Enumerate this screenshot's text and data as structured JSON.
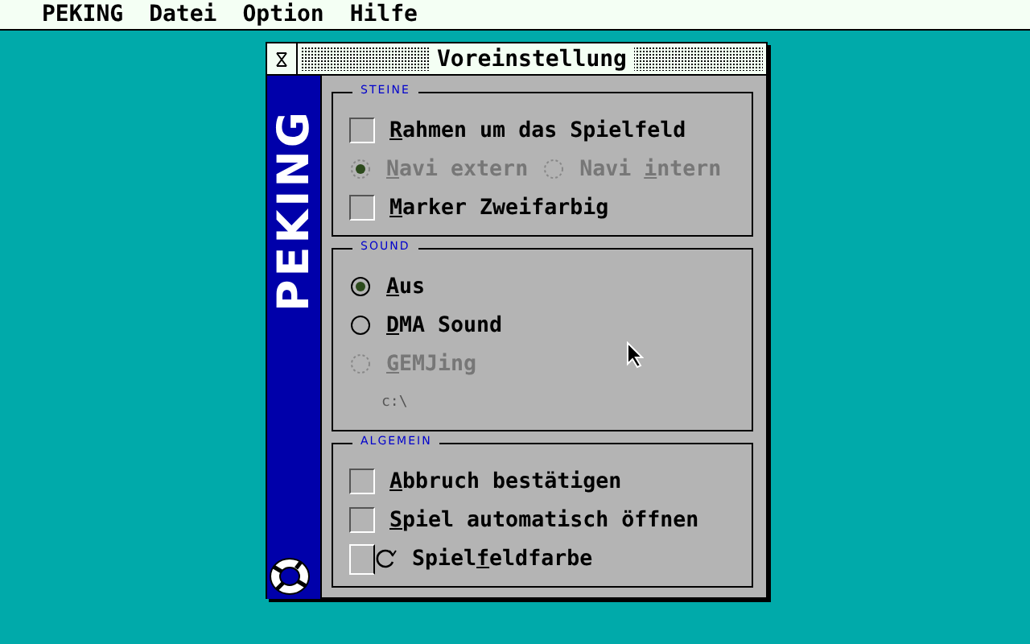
{
  "menu_bar": [
    {
      "label": "PEKING"
    },
    {
      "label": "Datei"
    },
    {
      "label": "Option"
    },
    {
      "label": "Hilfe"
    }
  ],
  "window": {
    "title": "Voreinstellung",
    "sidebar_label": "PEKING"
  },
  "groups": [
    {
      "title": "STEINE",
      "rows": [
        {
          "items": [
            {
              "kind": "checkbox",
              "key": "R",
              "after": "ahmen um das Spielfeld",
              "checked": false,
              "disabled": false
            }
          ]
        },
        {
          "items": [
            {
              "kind": "radio",
              "key": "N",
              "after": "avi extern",
              "selected": true,
              "disabled": true
            },
            {
              "kind": "radio",
              "before": "Navi ",
              "key": "i",
              "after": "ntern",
              "selected": false,
              "disabled": true
            }
          ]
        },
        {
          "items": [
            {
              "kind": "checkbox",
              "key": "M",
              "after": "arker Zweifarbig",
              "checked": false,
              "disabled": false
            }
          ]
        }
      ]
    },
    {
      "title": "SOUND",
      "rows": [
        {
          "items": [
            {
              "kind": "radio",
              "key": "A",
              "after": "us",
              "selected": true,
              "disabled": false
            }
          ]
        },
        {
          "items": [
            {
              "kind": "radio",
              "key": "D",
              "after": "MA Sound",
              "selected": false,
              "disabled": false
            }
          ]
        },
        {
          "items": [
            {
              "kind": "radio",
              "key": "G",
              "after": "EMJing",
              "selected": false,
              "disabled": true
            }
          ]
        },
        {
          "items": [
            {
              "kind": "path",
              "before": "c:\\",
              "disabled": true
            }
          ]
        }
      ]
    },
    {
      "title": "ALGEMEIN",
      "rows": [
        {
          "items": [
            {
              "kind": "checkbox",
              "key": "A",
              "after": "bbruch bestätigen",
              "checked": false,
              "disabled": false
            }
          ]
        },
        {
          "items": [
            {
              "kind": "checkbox",
              "key": "S",
              "after": "piel automatisch öffnen",
              "checked": false,
              "disabled": false
            }
          ]
        },
        {
          "items": [
            {
              "kind": "color",
              "before": "Spiel",
              "key": "f",
              "after": "eldfarbe",
              "disabled": false
            }
          ]
        }
      ]
    }
  ]
}
